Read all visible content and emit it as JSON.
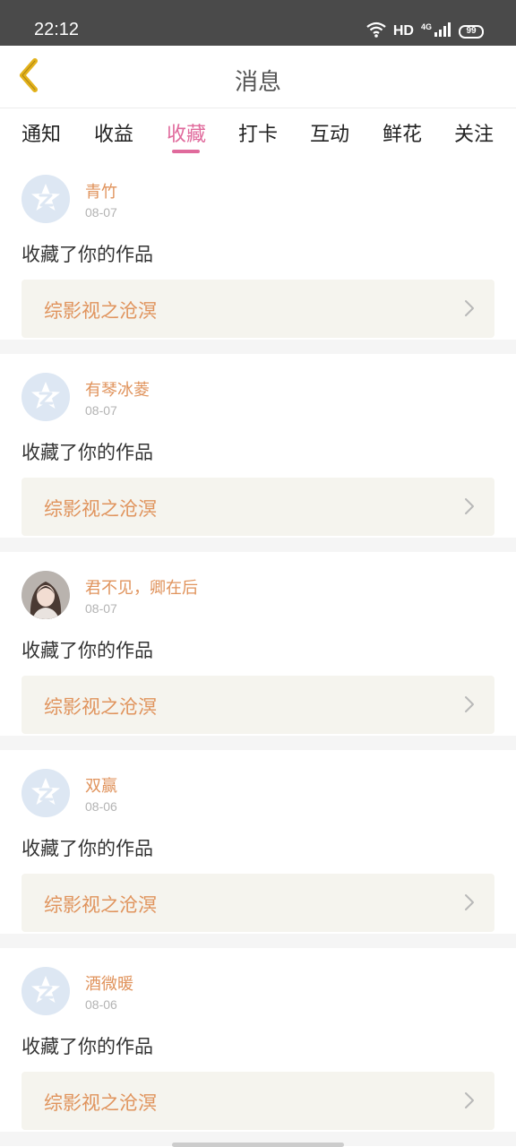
{
  "status_bar": {
    "time": "22:12",
    "network": "HD",
    "signal_type": "4G",
    "battery": "99"
  },
  "header": {
    "title": "消息",
    "back_icon": "chevron-left-icon",
    "back_icon_color": "#e3b21b"
  },
  "tabs": [
    {
      "label": "通知",
      "active": false
    },
    {
      "label": "收益",
      "active": false
    },
    {
      "label": "收藏",
      "active": true
    },
    {
      "label": "打卡",
      "active": false
    },
    {
      "label": "互动",
      "active": false
    },
    {
      "label": "鲜花",
      "active": false
    },
    {
      "label": "关注",
      "active": false
    }
  ],
  "colors": {
    "accent": "#e06a9c",
    "username": "#e0935c",
    "card_bg": "#f5f4ee"
  },
  "messages": [
    {
      "username": "青竹",
      "date": "08-07",
      "action": "收藏了你的作品",
      "work_title": "综影视之沧溟",
      "avatar": "default-avatar-icon"
    },
    {
      "username": "有琴冰菱",
      "date": "08-07",
      "action": "收藏了你的作品",
      "work_title": "综影视之沧溟",
      "avatar": "default-avatar-icon"
    },
    {
      "username": "君不见，卿在后",
      "date": "08-07",
      "action": "收藏了你的作品",
      "work_title": "综影视之沧溟",
      "avatar": "user-photo-avatar"
    },
    {
      "username": "双赢",
      "date": "08-06",
      "action": "收藏了你的作品",
      "work_title": "综影视之沧溟",
      "avatar": "default-avatar-icon"
    },
    {
      "username": "酒微暖",
      "date": "08-06",
      "action": "收藏了你的作品",
      "work_title": "综影视之沧溟",
      "avatar": "default-avatar-icon"
    }
  ]
}
